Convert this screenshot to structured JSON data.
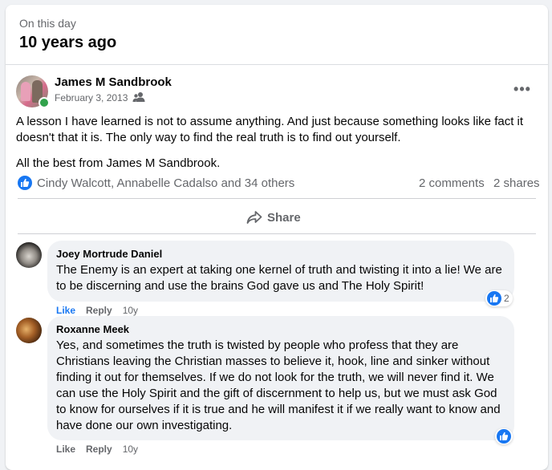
{
  "on_this_day": {
    "label": "On this day",
    "title": "10 years ago"
  },
  "post": {
    "author": "James M Sandbrook",
    "date": "February 3, 2013",
    "audience_icon": "friends-icon",
    "more_icon": "more-options-icon",
    "more_label": "•••",
    "paragraphs": [
      "A lesson I have learned is not to assume anything. And just because something looks like fact it doesn't that it is. The only way to find the real truth is to find out yourself.",
      "All the best from James M Sandbrook."
    ],
    "reactors": "Cindy Walcott, Annabelle Cadalso and 34 others",
    "comments_count": "2 comments",
    "shares_count": "2 shares",
    "share_label": "Share"
  },
  "comments": [
    {
      "name": "Joey Mortrude Daniel",
      "text": "The Enemy is an expert at taking one kernel of truth and twisting it into a lie! We are to be discerning and use the brains God gave us and The Holy Spirit!",
      "like_label": "Like",
      "reply_label": "Reply",
      "time": "10y",
      "reaction_count": "2"
    },
    {
      "name": "Roxanne Meek",
      "text": "Yes, and sometimes the truth is twisted by people who profess that they are Christians leaving the Christian masses to believe it, hook, line and sinker without finding it out for themselves. If we do not look for the truth, we will never find it. We can use the Holy Spirit and the gift of discernment to help us, but we must ask God to know for ourselves if it is true and he will manifest it if we really want to know and have done our own investigating.",
      "like_label": "Like",
      "reply_label": "Reply",
      "time": "10y"
    }
  ],
  "colors": {
    "accent": "#1877f2",
    "online": "#31a24c",
    "secondary_text": "#65676b",
    "bubble": "#f0f2f5"
  }
}
